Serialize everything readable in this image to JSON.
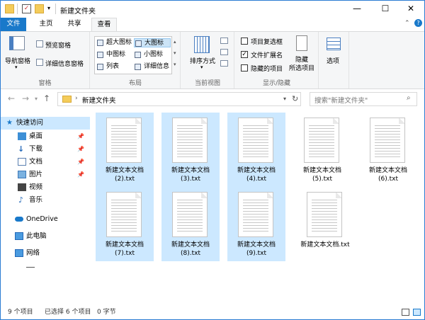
{
  "window": {
    "title": "新建文件夹",
    "controls": {
      "minimize": "—",
      "maximize": "☐",
      "close": "✕"
    }
  },
  "ribbon_tabs": [
    "文件",
    "主页",
    "共享",
    "查看"
  ],
  "ribbon": {
    "panes": {
      "navigation_pane": "导航窗格",
      "preview_pane": "预览窗格",
      "details_pane": "详细信息窗格",
      "label": "窗格"
    },
    "layout": {
      "options": [
        "超大图标",
        "大图标",
        "中图标",
        "小图标",
        "列表",
        "详细信息"
      ],
      "selected": "大图标",
      "label": "布局"
    },
    "current_view": {
      "sort_by": "排序方式",
      "label": "当前视图"
    },
    "show_hide": {
      "item_checkboxes": "项目复选框",
      "file_extensions": "文件扩展名",
      "hidden_items": "隐藏的项目",
      "hide_selected_1": "隐藏",
      "hide_selected_2": "所选项目",
      "label": "显示/隐藏",
      "checked": [
        "文件扩展名"
      ]
    },
    "options": {
      "label": "选项"
    }
  },
  "address": {
    "path": "新建文件夹",
    "search_placeholder": "搜索\"新建文件夹\""
  },
  "nav_pane": {
    "items": [
      {
        "label": "快速访问",
        "icon": "star-icon"
      },
      {
        "label": "桌面",
        "icon": "desktop-icon"
      },
      {
        "label": "下载",
        "icon": "download-icon"
      },
      {
        "label": "文档",
        "icon": "document-icon"
      },
      {
        "label": "图片",
        "icon": "picture-icon"
      },
      {
        "label": "视频",
        "icon": "video-icon"
      },
      {
        "label": "音乐",
        "icon": "music-icon"
      },
      {
        "label": "OneDrive",
        "icon": "cloud-icon"
      },
      {
        "label": "此电脑",
        "icon": "computer-icon"
      },
      {
        "label": "网络",
        "icon": "network-icon"
      }
    ]
  },
  "files": [
    {
      "line1": "新建文本文档",
      "line2": "(2).txt",
      "selected": true
    },
    {
      "line1": "新建文本文档",
      "line2": "(3).txt",
      "selected": true
    },
    {
      "line1": "新建文本文档",
      "line2": "(4).txt",
      "selected": true
    },
    {
      "line1": "新建文本文档",
      "line2": "(5).txt",
      "selected": false
    },
    {
      "line1": "新建文本文档",
      "line2": "(6).txt",
      "selected": false
    },
    {
      "line1": "新建文本文档",
      "line2": "(7).txt",
      "selected": true
    },
    {
      "line1": "新建文本文档",
      "line2": "(8).txt",
      "selected": true
    },
    {
      "line1": "新建文本文档",
      "line2": "(9).txt",
      "selected": true
    },
    {
      "line1": "新建文本文档.txt",
      "line2": "",
      "selected": false
    }
  ],
  "status": {
    "count": "9 个项目",
    "selection": "已选择 6 个项目",
    "size": "0 字节"
  },
  "colors": {
    "accent": "#1979ca",
    "selection": "#cce8ff"
  }
}
